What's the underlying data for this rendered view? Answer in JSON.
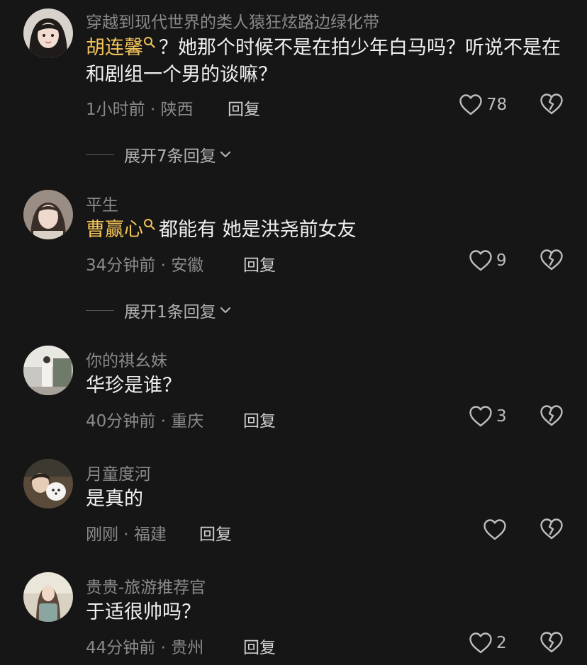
{
  "comments": [
    {
      "username": "穿越到现代世界的类人猿狂炫路边绿化带",
      "mention": "胡连馨",
      "text": "？她那个时候不是在拍少年白马吗？听说不是在和剧组一个男的谈嘛？",
      "time_location": "1小时前 · 陕西",
      "reply_label": "回复",
      "likes": "78",
      "expand_label": "展开7条回复"
    },
    {
      "username": "平生",
      "mention": "曹赢心",
      "text": "都能有  她是洪尧前女友",
      "time_location": "34分钟前 · 安徽",
      "reply_label": "回复",
      "likes": "9",
      "expand_label": "展开1条回复"
    },
    {
      "username": "你的祺幺妹",
      "text": "华珍是谁？",
      "time_location": "40分钟前 · 重庆",
      "reply_label": "回复",
      "likes": "3"
    },
    {
      "username": "月童度河",
      "text": "是真的",
      "time_location": "刚刚 · 福建",
      "reply_label": "回复",
      "likes": ""
    },
    {
      "username": "贵贵-旅游推荐官",
      "text": "于适很帅吗？",
      "time_location": "44分钟前 · 贵州",
      "reply_label": "回复",
      "likes": "2"
    }
  ],
  "colors": {
    "background": "#161616",
    "mention": "#f4c45a",
    "meta": "#8a8a8a"
  },
  "icons": [
    "search-icon",
    "heart-icon",
    "broken-heart-icon",
    "chevron-down-icon"
  ]
}
